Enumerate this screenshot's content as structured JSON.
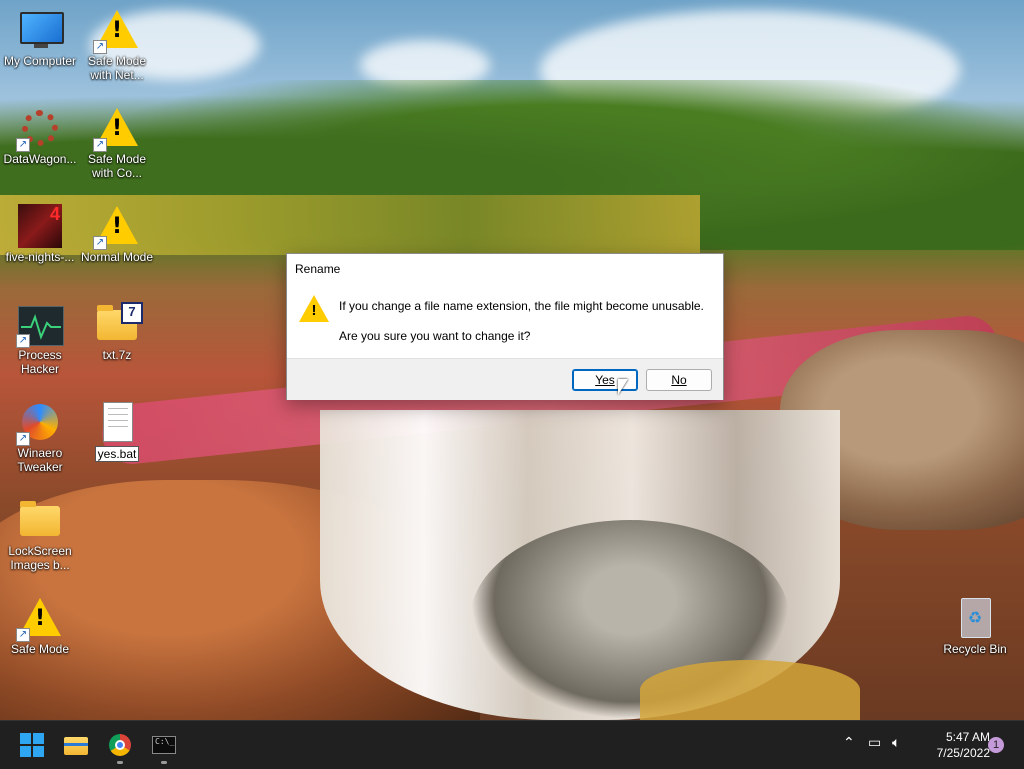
{
  "desktop": {
    "icons": [
      {
        "label": "My Computer"
      },
      {
        "label": "Safe Mode with Net..."
      },
      {
        "label": "DataWagon..."
      },
      {
        "label": "Safe Mode with Co..."
      },
      {
        "label": "five-nights-..."
      },
      {
        "label": "Normal Mode"
      },
      {
        "label": "Process Hacker"
      },
      {
        "label": "txt.7z"
      },
      {
        "label": "Winaero Tweaker"
      },
      {
        "label": "yes.bat"
      },
      {
        "label": "LockScreen Images b..."
      },
      {
        "label": "Safe Mode"
      },
      {
        "label": "Recycle Bin"
      }
    ]
  },
  "dialog": {
    "title": "Rename",
    "message_line1": "If you change a file name extension, the file might become unusable.",
    "message_line2": "Are you sure you want to change it?",
    "yes_label": "Yes",
    "no_label": "No",
    "icon": "warning-icon"
  },
  "taskbar": {
    "apps": [
      "start-icon",
      "file-explorer-icon",
      "chrome-icon",
      "terminal-icon"
    ],
    "tray": {
      "time": "5:47 AM",
      "date": "7/25/2022",
      "notification_count": "1"
    }
  },
  "colors": {
    "taskbar_bg": "#202020",
    "accent": "#0067c0",
    "warning": "#ffcc00"
  }
}
